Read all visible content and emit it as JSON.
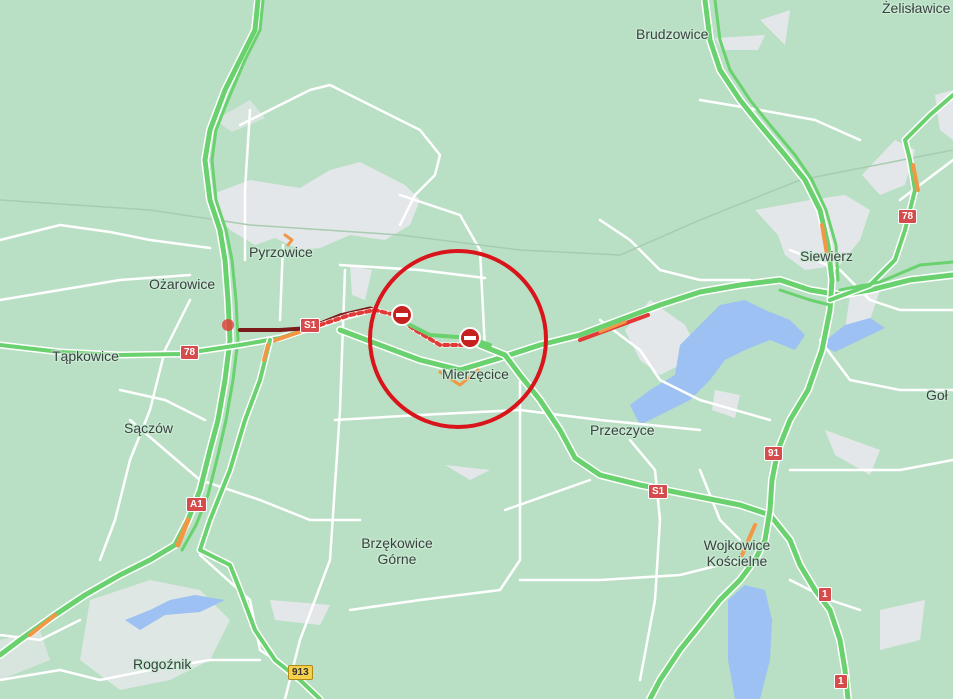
{
  "map": {
    "colors": {
      "land": "#b9e0c4",
      "urban": "#e4e7ea",
      "water": "#9cc1f2",
      "road_minor": "#ffffff",
      "highway": "#6ad16f",
      "traffic_slow": "#f29746",
      "traffic_jam": "#e23a36",
      "traffic_severe": "#7b1a1a",
      "highlight_circle": "#d9141b"
    },
    "places": {
      "zelislawice": "Żelisławice",
      "brudzowice": "Brudzowice",
      "pyrzowice": "Pyrzowice",
      "siewierz": "Siewierz",
      "ozarowice": "Ożarowice",
      "tapkowice": "Tąpkowice",
      "mierzecice": "Mierzęcice",
      "gol": "Goł",
      "saczow": "Sączów",
      "przeczyce": "Przeczyce",
      "brzekowice_1": "Brzękowice",
      "brzekowice_2": "Górne",
      "wojkowice_1": "Wojkowice",
      "wojkowice_2": "Kościelne",
      "rogoznik": "Rogoźnik"
    },
    "road_shields": {
      "s1_west": "S1",
      "s1_south": "S1",
      "r78_west": "78",
      "r78_east": "78",
      "a1": "A1",
      "r91": "91",
      "r1_a": "1",
      "r1_b": "1",
      "r913": "913"
    },
    "closure_icons": [
      "road-closed-icon",
      "road-closed-icon"
    ]
  }
}
